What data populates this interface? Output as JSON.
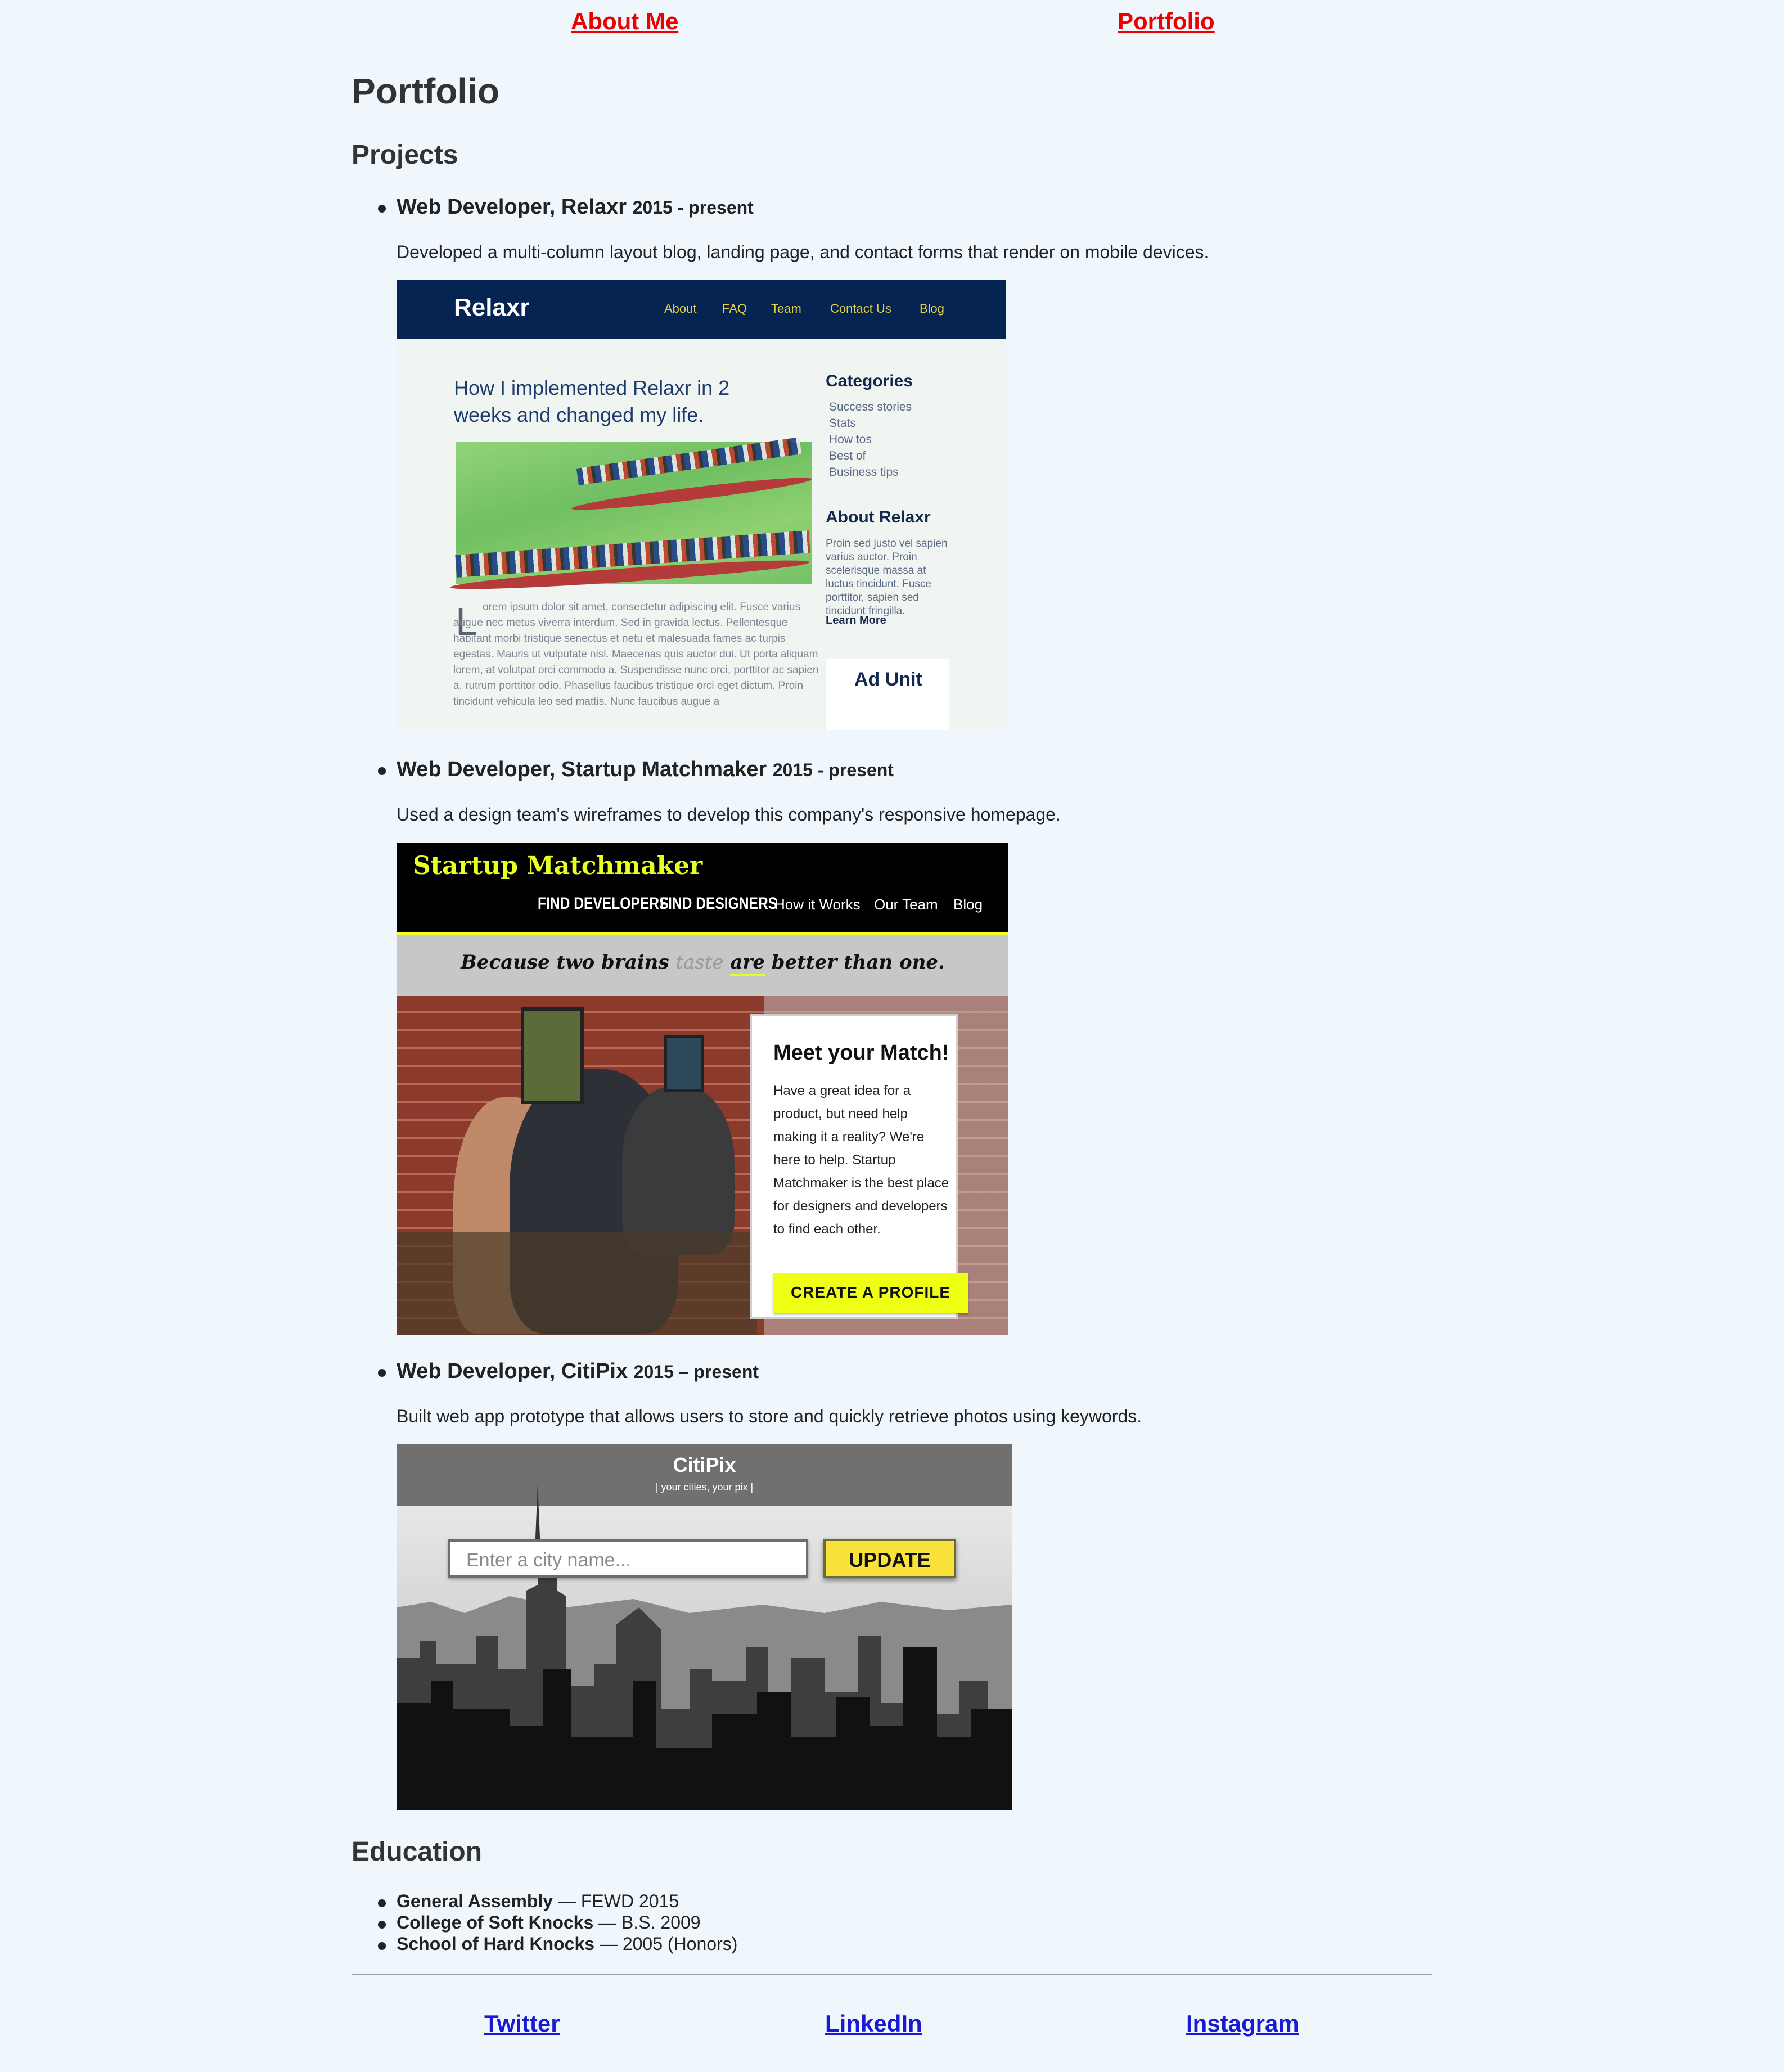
{
  "nav": {
    "about": "About Me",
    "portfolio": "Portfolio"
  },
  "page_title": "Portfolio",
  "projects_heading": "Projects",
  "projects": [
    {
      "title": "Web Developer, Relaxr",
      "years": "2015 - present",
      "description": "Developed a multi-column layout blog, landing page, and contact forms that render on mobile devices.",
      "screenshot": {
        "logo": "Relaxr",
        "nav": [
          "About",
          "FAQ",
          "Team",
          "Contact Us",
          "Blog"
        ],
        "post_title": "How I implemented Relaxr in 2 weeks and changed my life.",
        "drop_cap": "L",
        "body": "orem ipsum dolor sit amet, consectetur adipiscing elit. Fusce varius augue nec metus viverra interdum. Sed in gravida lectus. Pellentesque habitant morbi tristique senectus et netu et malesuada fames ac turpis egestas. Mauris ut vulputate nisl. Maecenas quis auctor dui. Ut porta aliquam lorem, at volutpat orci commodo a. Suspendisse nunc orci, porttitor ac sapien a, rutrum porttitor odio. Phasellus faucibus tristique orci eget dictum. Proin tincidunt vehicula leo sed mattis. Nunc faucibus augue a",
        "categories_heading": "Categories",
        "categories": [
          "Success stories",
          "Stats",
          "How tos",
          "Best of",
          "Business tips"
        ],
        "about_heading": "About Relaxr",
        "about_text": "Proin sed justo vel sapien varius auctor. Proin scelerisque massa at luctus tincidunt. Fusce porttitor, sapien sed tincidunt fringilla.",
        "learn_more": "Learn More",
        "ad_unit": "Ad Unit"
      }
    },
    {
      "title": "Web Developer, Startup Matchmaker",
      "years": "2015 - present",
      "description": "Used a design team's wireframes to develop this company's responsive homepage.",
      "screenshot": {
        "logo": "Startup Matchmaker",
        "nav": [
          "FIND DEVELOPERS",
          "FIND DESIGNERS",
          "How it Works",
          "Our Team",
          "Blog"
        ],
        "tagline_1": "Because two brains ",
        "tagline_strike": "taste",
        "tagline_are": "are",
        "tagline_2": " better than one.",
        "card_title": "Meet your Match!",
        "card_text": "Have a great idea for a product, but need help making it a reality? We're here to help. Startup Matchmaker is the best place for designers and developers to find each other.",
        "cta": "CREATE A PROFILE"
      }
    },
    {
      "title": "Web Developer, CitiPix",
      "years": "2015 – present",
      "description": "Built web app prototype that allows users to store and quickly retrieve photos using keywords.",
      "screenshot": {
        "logo": "CitiPix",
        "tagline": "| your cities, your pix |",
        "input_placeholder": "Enter a city name...",
        "button": "UPDATE"
      }
    }
  ],
  "education_heading": "Education",
  "education": [
    {
      "school": "General Assembly",
      "detail": " — FEWD 2015"
    },
    {
      "school": "College of Soft Knocks",
      "detail": " — B.S. 2009"
    },
    {
      "school": "School of Hard Knocks",
      "detail": " — 2005 (Honors)"
    }
  ],
  "social": {
    "twitter": "Twitter",
    "linkedin": "LinkedIn",
    "instagram": "Instagram"
  },
  "colors": {
    "background": "#eff7fd",
    "nav_link": "#ee0000",
    "social_link": "#1a1ad4",
    "text": "#333333"
  }
}
